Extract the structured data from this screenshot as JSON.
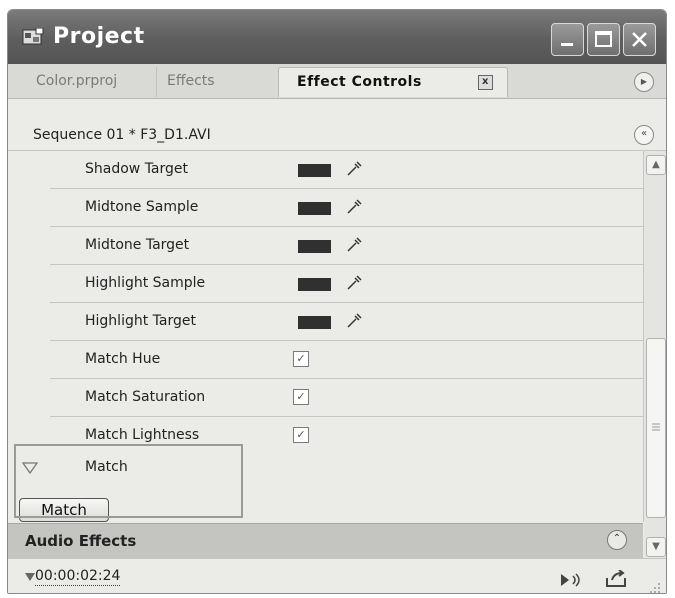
{
  "window": {
    "title": "Project"
  },
  "tabs": [
    {
      "label": "Color.prproj"
    },
    {
      "label": "Effects"
    },
    {
      "label": "Effect Controls",
      "close": "x"
    }
  ],
  "sequence": {
    "label": "Sequence 01 * F3_D1.AVI"
  },
  "properties": [
    {
      "label": "Shadow Target",
      "kind": "color",
      "value": "#303030"
    },
    {
      "label": "Midtone Sample",
      "kind": "color",
      "value": "#303030"
    },
    {
      "label": "Midtone Target",
      "kind": "color",
      "value": "#303030"
    },
    {
      "label": "Highlight Sample",
      "kind": "color",
      "value": "#303030"
    },
    {
      "label": "Highlight Target",
      "kind": "color",
      "value": "#303030"
    },
    {
      "label": "Match Hue",
      "kind": "checkbox",
      "checked": true
    },
    {
      "label": "Match Saturation",
      "kind": "checkbox",
      "checked": true
    },
    {
      "label": "Match Lightness",
      "kind": "checkbox",
      "checked": true
    }
  ],
  "match_section": {
    "label": "Match",
    "button_label": "Match"
  },
  "audio_effects": {
    "label": "Audio Effects"
  },
  "footer": {
    "timecode": "00:00:02:24"
  },
  "colors": {
    "title_bar": "#5e5e5e",
    "panel_bg": "#ebebe8",
    "swatch": "#303030",
    "audio_bar": "#c4c4c0"
  },
  "icons": {
    "app": "premiere-project-icon",
    "picker": "eyedropper-icon",
    "toggle": "triangle-down-icon",
    "panel_menu": "panel-menu-icon",
    "collapse": "double-chevron-left-icon",
    "audio_toggle": "double-chevron-up-icon",
    "play_audio": "play-audio-icon",
    "export": "export-icon"
  }
}
